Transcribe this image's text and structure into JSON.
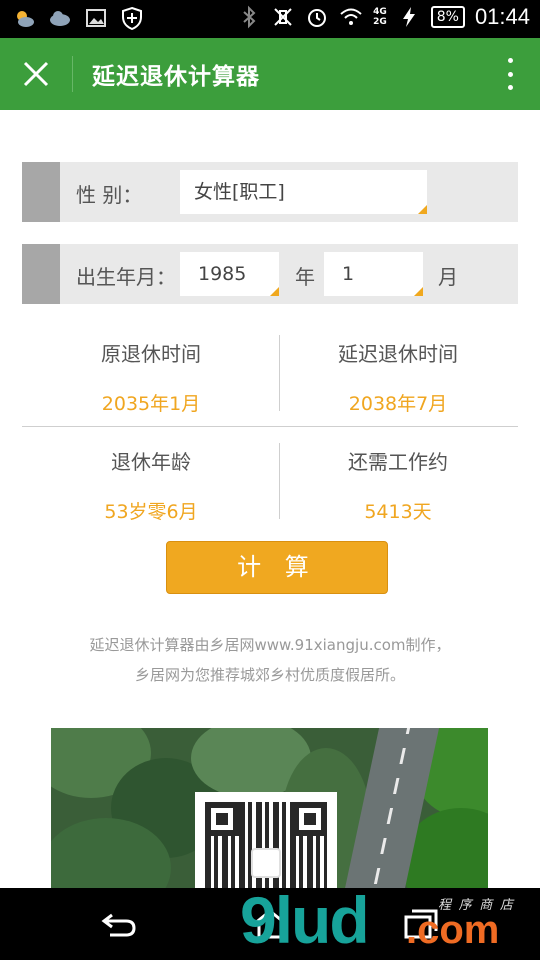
{
  "status_bar": {
    "icons": [
      "weather-icon",
      "cloud-icon",
      "image-icon",
      "shield-icon",
      "bluetooth-icon",
      "vibrate-off-icon",
      "alarm-icon",
      "wifi-icon"
    ],
    "network_top": "4G",
    "network_bottom": "2G",
    "battery": "8%",
    "time": "01:44"
  },
  "app_bar": {
    "title": "延迟退休计算器"
  },
  "form": {
    "gender_label": "性 别：",
    "gender_value": "女性[职工]",
    "birth_label": "出生年月：",
    "birth_year": "1985",
    "year_unit": "年",
    "birth_month": "1",
    "month_unit": "月"
  },
  "results": {
    "original_label": "原退休时间",
    "original_value": "2035年1月",
    "delayed_label": "延迟退休时间",
    "delayed_value": "2038年7月",
    "age_label": "退休年龄",
    "age_value": "53岁零6月",
    "remaining_label": "还需工作约",
    "remaining_value": "5413天"
  },
  "calculate_label": "计 算",
  "footer_note": {
    "line1": "延迟退休计算器由乡居网www.91xiangju.com制作，",
    "line2": "乡居网为您推荐城郊乡村优质度假居所。"
  },
  "watermark": {
    "main": "9lud",
    "suffix": ".com",
    "small": "程 序 商 店"
  },
  "colors": {
    "app_bar": "#3c9e3c",
    "accent": "#f0a820",
    "row_bg": "#e9e9e9",
    "row_tab": "#a7a7a7"
  }
}
